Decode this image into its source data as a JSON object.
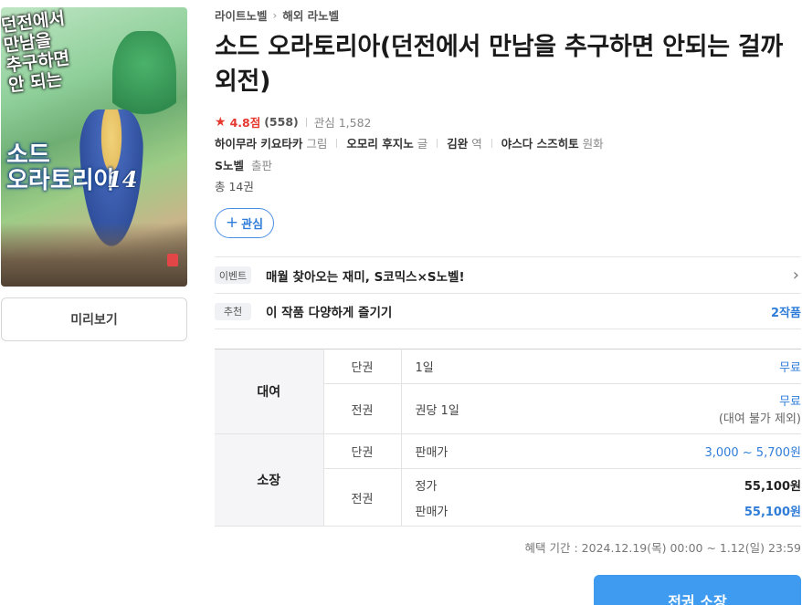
{
  "cover": {
    "title_top": "던전에서\n만남을\n추구하면\n안 되는",
    "title_main": "소드\n오라토리아",
    "volume": "14"
  },
  "preview_label": "미리보기",
  "breadcrumb": [
    "라이트노벨",
    "해외 라노벨"
  ],
  "breadcrumb_sep": "›",
  "title": "소드 오라토리아(던전에서 만남을 추구하면 안되는 걸까 외전)",
  "rating": {
    "icon": "star-icon",
    "score": "4.8점",
    "count": "(558)",
    "interest_label": "관심 1,582"
  },
  "credits": [
    {
      "name": "하이무라 키요타카",
      "role": "그림"
    },
    {
      "name": "오모리 후지노",
      "role": "글"
    },
    {
      "name": "김완",
      "role": "역"
    },
    {
      "name": "야스다 스즈히토",
      "role": "원화"
    }
  ],
  "publisher": {
    "name": "S노벨",
    "role": "출판"
  },
  "total": "총 14권",
  "wish_label": "관심",
  "promos": [
    {
      "tag": "이벤트",
      "text": "매월 찾아오는 재미, S코믹스×S노벨!",
      "right": "›"
    },
    {
      "tag": "추천",
      "text": "이 작품 다양하게 즐기기",
      "right": "2작품"
    }
  ],
  "price_table": {
    "rental": {
      "group": "대여",
      "single": {
        "kind": "단권",
        "option": "1일",
        "value": "무료"
      },
      "all": {
        "kind": "전권",
        "option": "권당 1일",
        "value": "무료",
        "note": "(대여 불가 제외)"
      }
    },
    "own": {
      "group": "소장",
      "single": {
        "kind": "단권",
        "option": "판매가",
        "value": "3,000 ~ 5,700원"
      },
      "all": {
        "kind": "전권",
        "list_label": "정가",
        "list_value": "55,100원",
        "sale_label": "판매가",
        "sale_value": "55,100원"
      }
    }
  },
  "benefit_period": "혜택 기간 : 2024.12.19(목) 00:00 ~ 1.12(일) 23:59",
  "buy_all_label": "전권 소장",
  "colors": {
    "accent": "#3f9bf0",
    "link_blue": "#2f7dd8",
    "rating_red": "#e5392f"
  }
}
